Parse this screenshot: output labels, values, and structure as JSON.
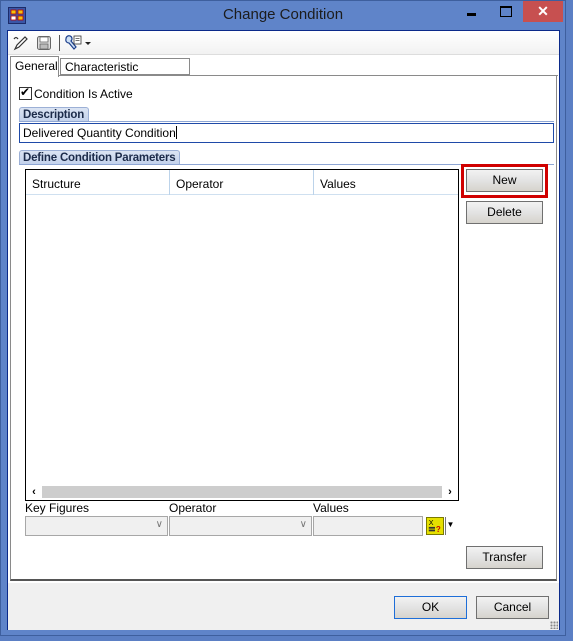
{
  "window": {
    "title": "Change Condition",
    "controls": {
      "minimize": "minimize",
      "maximize": "maximize",
      "close": "✕"
    }
  },
  "toolbar": {
    "icons": [
      "edit-icon",
      "save-icon",
      "tools-icon",
      "dropdown-arrow-icon"
    ]
  },
  "tabs": [
    {
      "label": "General",
      "active": true
    },
    {
      "label": "Characteristic Assignment",
      "active": false
    }
  ],
  "general": {
    "condition_active_label": "Condition Is Active",
    "condition_active_checked": true,
    "description_header": "Description",
    "description_value": "Delivered Quantity Condition",
    "params_header": "Define Condition Parameters",
    "grid_columns": [
      "Structure",
      "Operator",
      "Values"
    ],
    "grid_rows": [],
    "new_label": "New",
    "delete_label": "Delete",
    "key_figures_label": "Key Figures",
    "key_figures_value": "",
    "operator_label": "Operator",
    "operator_value": "",
    "values_label": "Values",
    "values_value": "",
    "transfer_label": "Transfer"
  },
  "footer": {
    "ok_label": "OK",
    "cancel_label": "Cancel"
  },
  "colors": {
    "title_bar": "#5f84c9",
    "close_button": "#c75050",
    "highlight_box": "#d00000",
    "group_header": "#c3d2ec"
  }
}
